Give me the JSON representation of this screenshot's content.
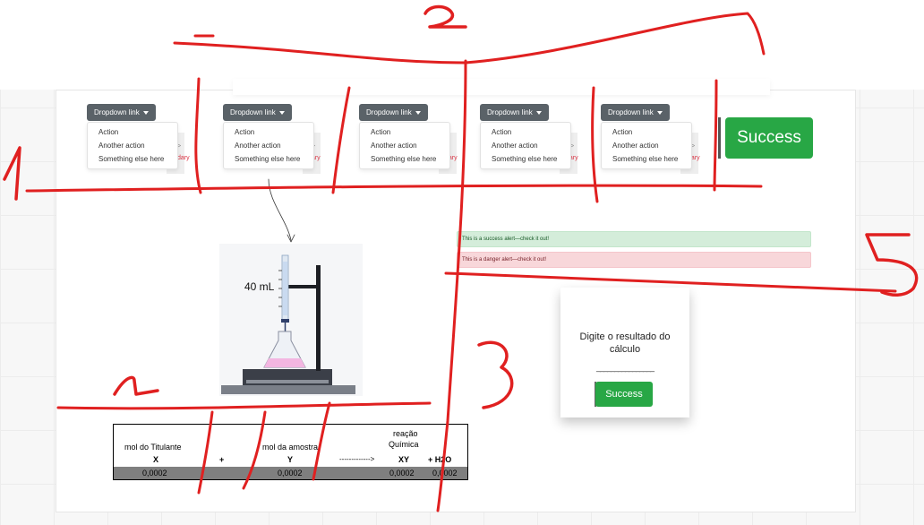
{
  "dropdowns": [
    {
      "button_label": "Dropdown link",
      "items": [
        "Action",
        "Another action",
        "Something else here"
      ]
    },
    {
      "button_label": "Dropdown link",
      "items": [
        "Action",
        "Another action",
        "Something else here"
      ]
    },
    {
      "button_label": "Dropdown link",
      "items": [
        "Action",
        "Another action",
        "Something else here"
      ]
    },
    {
      "button_label": "Dropdown link",
      "items": [
        "Action",
        "Another action",
        "Something else here"
      ]
    },
    {
      "button_label": "Dropdown link",
      "items": [
        "Action",
        "Another action",
        "Something else here"
      ]
    }
  ],
  "behind_text": {
    "a": "/>",
    "b": "dary"
  },
  "success_button": "Success",
  "alerts": {
    "success": "This is a success alert—check it out!",
    "danger": "This is a danger alert—check it out!"
  },
  "burette_label": "40 mL",
  "card": {
    "text": "Digite o resultado do cálculo",
    "blank": "________________",
    "button": "Success"
  },
  "table": {
    "h_titulante": "mol do Titulante",
    "h_amostra": "mol da amostra",
    "h_reacao": "reação",
    "h_quimica": "Química",
    "x": "X",
    "plus1": "+",
    "y": "Y",
    "arrow": "------------->",
    "xy": "XY",
    "plus_h2o": "+ H2O",
    "v1": "0,0002",
    "v2": "0,0002",
    "v3": "0,0002",
    "v4": "0,0002"
  },
  "annotations": [
    "1",
    "2",
    "3",
    "4",
    "5"
  ],
  "colors": {
    "success": "#28a745",
    "dropdown": "#5a6268",
    "annotation": "#e02020"
  }
}
